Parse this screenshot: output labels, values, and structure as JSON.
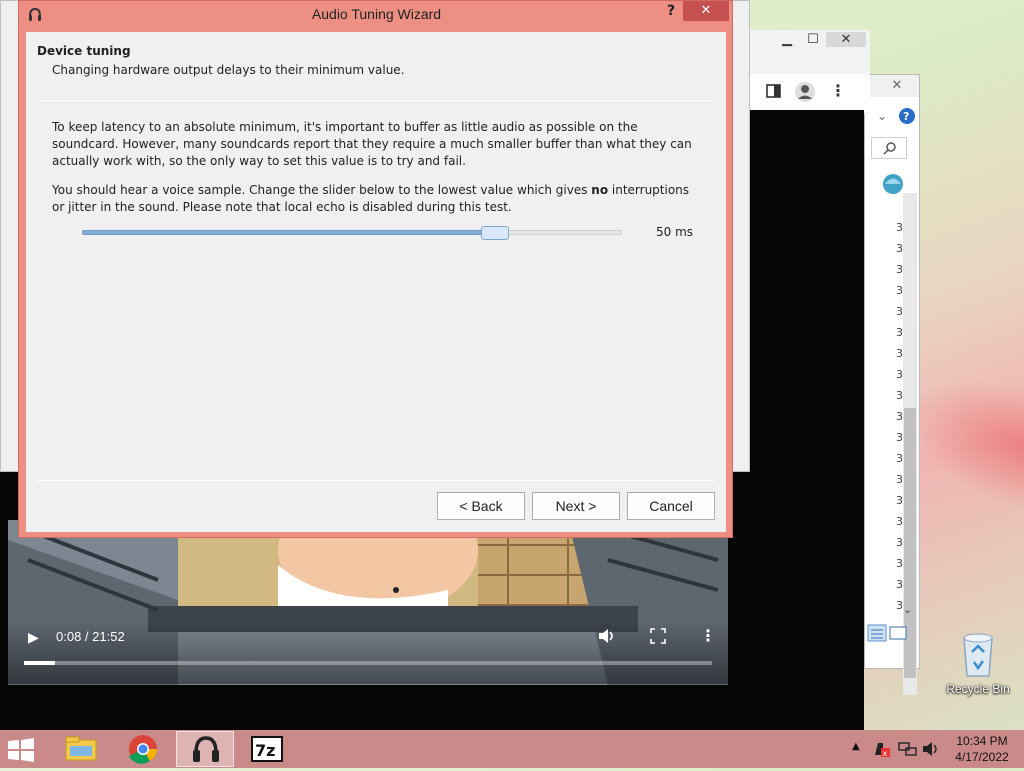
{
  "dialog": {
    "title": "Audio Tuning Wizard",
    "help_label": "?",
    "close_label": "✕",
    "heading": "Device tuning",
    "subheading": "Changing hardware output delays to their minimum value.",
    "paragraph1": "To keep latency to an absolute minimum, it's important to buffer as little audio as possible on the soundcard. However, many soundcards report that they require a much smaller buffer than what they can actually work with, so the only way to set this value is to try and fail.",
    "paragraph2_before": "You should hear a voice sample. Change the slider below to the lowest value which gives ",
    "paragraph2_bold": "no",
    "paragraph2_after": " interruptions or jitter in the sound. Please note that local echo is disabled during this test.",
    "slider": {
      "value_label": "50 ms",
      "fraction": 0.78
    },
    "buttons": {
      "back": "< Back",
      "next": "Next >",
      "cancel": "Cancel"
    }
  },
  "video": {
    "time": "0:08 / 21:52",
    "progress_fraction": 0.045
  },
  "desktop": {
    "recycle_bin_label": "Recycle Bin"
  },
  "bg_window3": {
    "row_glyph": "3"
  },
  "taskbar": {
    "apps": [
      "file-explorer-icon",
      "chrome-icon",
      "mumble-icon",
      "7zip-icon"
    ],
    "clock_time": "10:34 PM",
    "clock_date": "4/17/2022"
  },
  "colors": {
    "dialog_frame": "#ee8f84",
    "close_button": "#c75050",
    "taskbar": "#cb8a8a",
    "slider_fill": "#84aed6"
  }
}
